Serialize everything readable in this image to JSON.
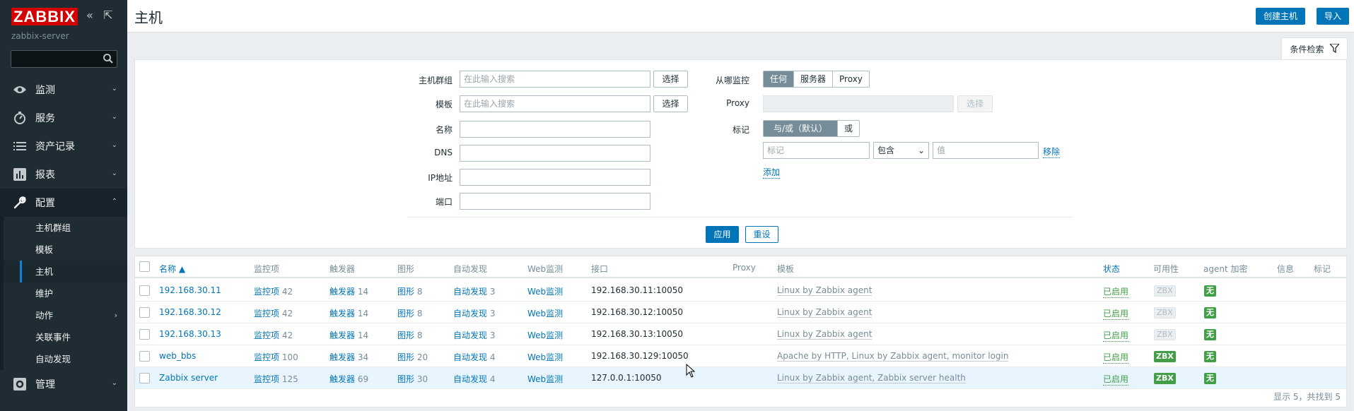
{
  "sidebar": {
    "logo": "ZABBIX",
    "server_name": "zabbix-server",
    "search_placeholder": "",
    "menu": [
      {
        "label": "监测",
        "icon": "eye-icon"
      },
      {
        "label": "服务",
        "icon": "clock-icon"
      },
      {
        "label": "资产记录",
        "icon": "list-icon"
      },
      {
        "label": "报表",
        "icon": "chart-icon"
      },
      {
        "label": "配置",
        "icon": "wrench-icon"
      },
      {
        "label": "管理",
        "icon": "gear-icon"
      }
    ],
    "submenu": [
      "主机群组",
      "模板",
      "主机",
      "维护",
      "动作",
      "关联事件",
      "自动发现"
    ],
    "active_submenu": "主机"
  },
  "header": {
    "title": "主机",
    "create_host": "创建主机",
    "import": "导入"
  },
  "filter": {
    "tab_label": "条件检索",
    "host_groups_label": "主机群组",
    "host_groups_placeholder": "在此输入搜索",
    "templates_label": "模板",
    "templates_placeholder": "在此输入搜索",
    "select": "选择",
    "name_label": "名称",
    "dns_label": "DNS",
    "ip_label": "IP地址",
    "port_label": "端口",
    "monitored_by_label": "从哪监控",
    "monitored_by_options": [
      "任何",
      "服务器",
      "Proxy"
    ],
    "proxy_label": "Proxy",
    "tags_label": "标记",
    "tags_mode_options": [
      "与/或（默认）",
      "或"
    ],
    "tag_placeholder": "标记",
    "tag_operator": "包含",
    "value_placeholder": "值",
    "remove": "移除",
    "add": "添加",
    "apply": "应用",
    "reset": "重设"
  },
  "table": {
    "headers": {
      "name": "名称 ▲",
      "items": "监控项",
      "triggers": "触发器",
      "graphs": "图形",
      "discovery": "自动发现",
      "web": "Web监测",
      "interface": "接口",
      "proxy": "Proxy",
      "templates": "模板",
      "status": "状态",
      "availability": "可用性",
      "encryption": "agent 加密",
      "info": "信息",
      "tags": "标记"
    },
    "rows": [
      {
        "name": "192.168.30.11",
        "items_label": "监控项",
        "items": "42",
        "triggers_label": "触发器",
        "triggers": "14",
        "graphs_label": "图形",
        "graphs": "8",
        "discovery_label": "自动发现",
        "discovery": "3",
        "web": "Web监测",
        "interface": "192.168.30.11:10050",
        "templates": "Linux by Zabbix agent",
        "status": "已启用",
        "zbx": "ZBX",
        "enc": "无"
      },
      {
        "name": "192.168.30.12",
        "items_label": "监控项",
        "items": "42",
        "triggers_label": "触发器",
        "triggers": "14",
        "graphs_label": "图形",
        "graphs": "8",
        "discovery_label": "自动发现",
        "discovery": "3",
        "web": "Web监测",
        "interface": "192.168.30.12:10050",
        "templates": "Linux by Zabbix agent",
        "status": "已启用",
        "zbx": "ZBX",
        "enc": "无"
      },
      {
        "name": "192.168.30.13",
        "items_label": "监控项",
        "items": "42",
        "triggers_label": "触发器",
        "triggers": "14",
        "graphs_label": "图形",
        "graphs": "8",
        "discovery_label": "自动发现",
        "discovery": "3",
        "web": "Web监测",
        "interface": "192.168.30.13:10050",
        "templates": "Linux by Zabbix agent",
        "status": "已启用",
        "zbx": "ZBX",
        "enc": "无"
      },
      {
        "name": "web_bbs",
        "items_label": "监控项",
        "items": "100",
        "triggers_label": "触发器",
        "triggers": "34",
        "graphs_label": "图形",
        "graphs": "20",
        "discovery_label": "自动发现",
        "discovery": "4",
        "web": "Web监测",
        "interface": "192.168.30.129:10050",
        "templates": "Apache by HTTP, Linux by Zabbix agent, monitor login",
        "status": "已启用",
        "zbx": "ZBX",
        "enc": "无"
      },
      {
        "name": "Zabbix server",
        "items_label": "监控项",
        "items": "125",
        "triggers_label": "触发器",
        "triggers": "69",
        "graphs_label": "图形",
        "graphs": "30",
        "discovery_label": "自动发现",
        "discovery": "4",
        "web": "Web监测",
        "interface": "127.0.0.1:10050",
        "templates": "Linux by Zabbix agent, Zabbix server health",
        "status": "已启用",
        "zbx": "ZBX",
        "enc": "无"
      }
    ],
    "footer": "显示 5，共找到 5"
  },
  "colors": {
    "sidebar_bg": "#1f2c33",
    "accent": "#0275b8",
    "logo_red": "#d40000",
    "enabled_green": "#429e47"
  }
}
